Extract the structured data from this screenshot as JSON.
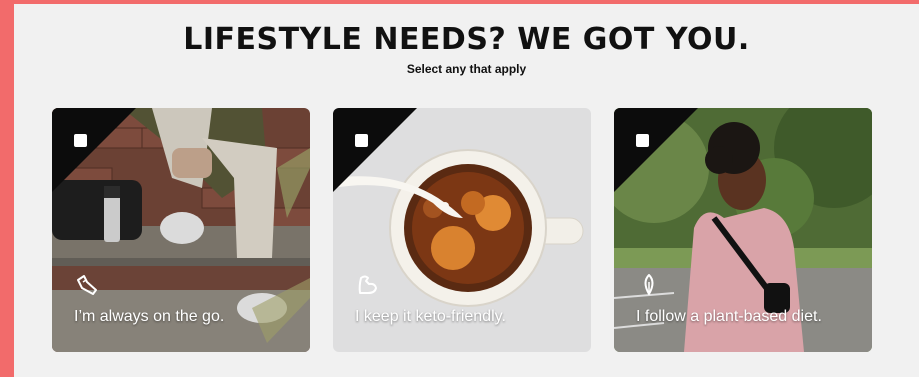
{
  "header": {
    "title": "LIFESTYLE NEEDS? WE GOT YOU.",
    "subtitle": "Select any that apply"
  },
  "cards": [
    {
      "label": "I’m always on the go.",
      "icon": "sneaker-icon",
      "selected": false
    },
    {
      "label": "I keep it keto-friendly.",
      "icon": "flexed-arm-icon",
      "selected": false
    },
    {
      "label": "I follow a plant-based diet.",
      "icon": "leaf-icon",
      "selected": false
    }
  ],
  "colors": {
    "frame": "#f26b6b",
    "panel": "#f1f1f1",
    "corner": "#0c0c0c",
    "checkbox": "#ffffff"
  }
}
